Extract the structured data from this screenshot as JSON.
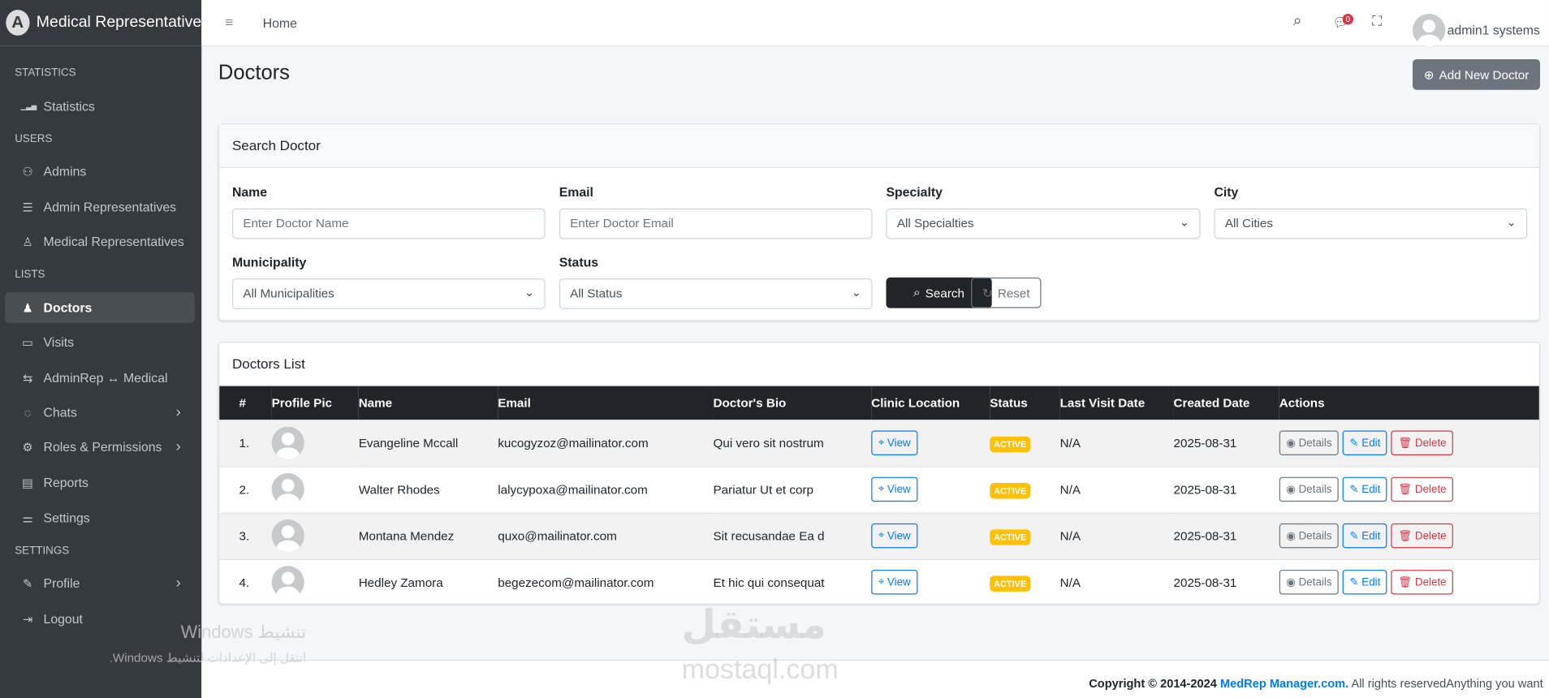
{
  "sidebar": {
    "brand": "Medical Representative",
    "logo_letter": "A",
    "sections": {
      "statistics": "STATISTICS",
      "users": "USERS",
      "lists": "LISTS",
      "settings": "SETTINGS"
    },
    "items": [
      {
        "label": "Statistics",
        "icon": "bar-chart-icon"
      },
      {
        "label": "Admins",
        "icon": "user-gear-icon"
      },
      {
        "label": "Admin Representatives",
        "icon": "user-list-icon"
      },
      {
        "label": "Medical Representatives",
        "icon": "user-icon"
      },
      {
        "label": "Doctors",
        "icon": "doctor-icon",
        "active": true
      },
      {
        "label": "Visits",
        "icon": "briefcase-icon"
      },
      {
        "label": "AdminRep ↔ Medical",
        "icon": "arrows-icon"
      },
      {
        "label": "Chats",
        "icon": "chat-icon"
      },
      {
        "label": "Roles & Permissions",
        "icon": "gear-icon"
      },
      {
        "label": "Reports",
        "icon": "report-icon"
      },
      {
        "label": "Settings",
        "icon": "sliders-icon"
      },
      {
        "label": "Profile",
        "icon": "edit-icon"
      },
      {
        "label": "Logout",
        "icon": "logout-icon"
      }
    ]
  },
  "header": {
    "breadcrumb": "Home",
    "chat_badge": "0",
    "user": "admin1 systems"
  },
  "page": {
    "title": "Doctors",
    "add_button": "Add New Doctor"
  },
  "search": {
    "title": "Search Doctor",
    "name_label": "Name",
    "name_placeholder": "Enter Doctor Name",
    "email_label": "Email",
    "email_placeholder": "Enter Doctor Email",
    "specialty_label": "Specialty",
    "specialty_value": "All Specialties",
    "city_label": "City",
    "city_value": "All Cities",
    "municipality_label": "Municipality",
    "municipality_value": "All Municipalities",
    "status_label": "Status",
    "status_value": "All Status",
    "search_button": "Search",
    "reset_button": "Reset"
  },
  "list": {
    "title": "Doctors List",
    "columns": [
      "#",
      "Profile Pic",
      "Name",
      "Email",
      "Doctor's Bio",
      "Clinic Location",
      "Status",
      "Last Visit Date",
      "Created Date",
      "Actions"
    ],
    "view_label": "View",
    "details_label": "Details",
    "edit_label": "Edit",
    "delete_label": "Delete",
    "rows": [
      {
        "num": "1.",
        "name": "Evangeline Mccall",
        "email": "kucogyzoz@mailinator.com",
        "bio": "Qui vero sit nostrum",
        "status": "ACTIVE",
        "last_visit": "N/A",
        "created": "2025-08-31"
      },
      {
        "num": "2.",
        "name": "Walter Rhodes",
        "email": "lalycypoxa@mailinator.com",
        "bio": "Pariatur Ut et corp",
        "status": "ACTIVE",
        "last_visit": "N/A",
        "created": "2025-08-31"
      },
      {
        "num": "3.",
        "name": "Montana Mendez",
        "email": "quxo@mailinator.com",
        "bio": "Sit recusandae Ea d",
        "status": "ACTIVE",
        "last_visit": "N/A",
        "created": "2025-08-31"
      },
      {
        "num": "4.",
        "name": "Hedley Zamora",
        "email": "begezecom@mailinator.com",
        "bio": "Et hic qui consequat",
        "status": "ACTIVE",
        "last_visit": "N/A",
        "created": "2025-08-31"
      }
    ]
  },
  "footer": {
    "copyright": "Copyright © 2014-2024",
    "link": "MedRep Manager.com.",
    "rest": "All rights reservedAnything you want"
  },
  "overlay": {
    "windows_title": "تنشيط Windows",
    "windows_sub": "انتقل إلى الإعدادات لتنشيط Windows.",
    "watermark_logo": "مستقل",
    "watermark_url": "mostaql.com"
  }
}
